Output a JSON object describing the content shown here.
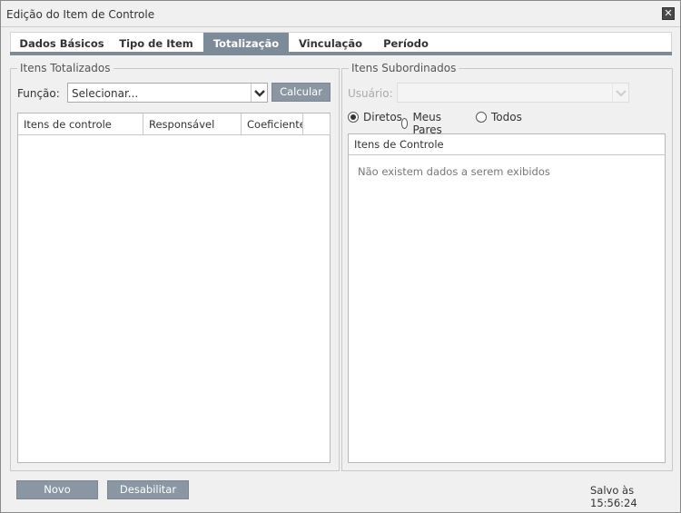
{
  "window": {
    "title": "Edição do Item de Controle",
    "close_glyph": "✕"
  },
  "tabs": [
    {
      "label": "Dados Básicos"
    },
    {
      "label": "Tipo de Item"
    },
    {
      "label": "Totalização",
      "active": true
    },
    {
      "label": "Vinculação"
    },
    {
      "label": "Período"
    }
  ],
  "left_group": {
    "legend": "Itens Totalizados",
    "funcao_label": "Função:",
    "funcao_value": "Selecionar...",
    "calc_button": "Calcular",
    "columns": [
      "Itens de controle",
      "Responsável",
      "Coeficiente",
      ""
    ]
  },
  "right_group": {
    "legend": "Itens Subordinados",
    "usuario_label": "Usuário:",
    "usuario_value": "",
    "radios": [
      {
        "label": "Diretos",
        "checked": true
      },
      {
        "label": "Meus Pares",
        "checked": false
      },
      {
        "label": "Todos",
        "checked": false
      }
    ],
    "column": "Itens de Controle",
    "empty_message": "Não existem dados a serem exibidos"
  },
  "footer": {
    "novo_button": "Novo",
    "desabilitar_button": "Desabilitar",
    "status": "Salvo às 15:56:24"
  },
  "icons": {
    "close": "close-icon",
    "dropdown": "chevron-down-icon",
    "radio": "radio-icon"
  },
  "colors": {
    "accent": "#7d8a97",
    "button": "#8a97a3",
    "background": "#f0f0f0"
  }
}
